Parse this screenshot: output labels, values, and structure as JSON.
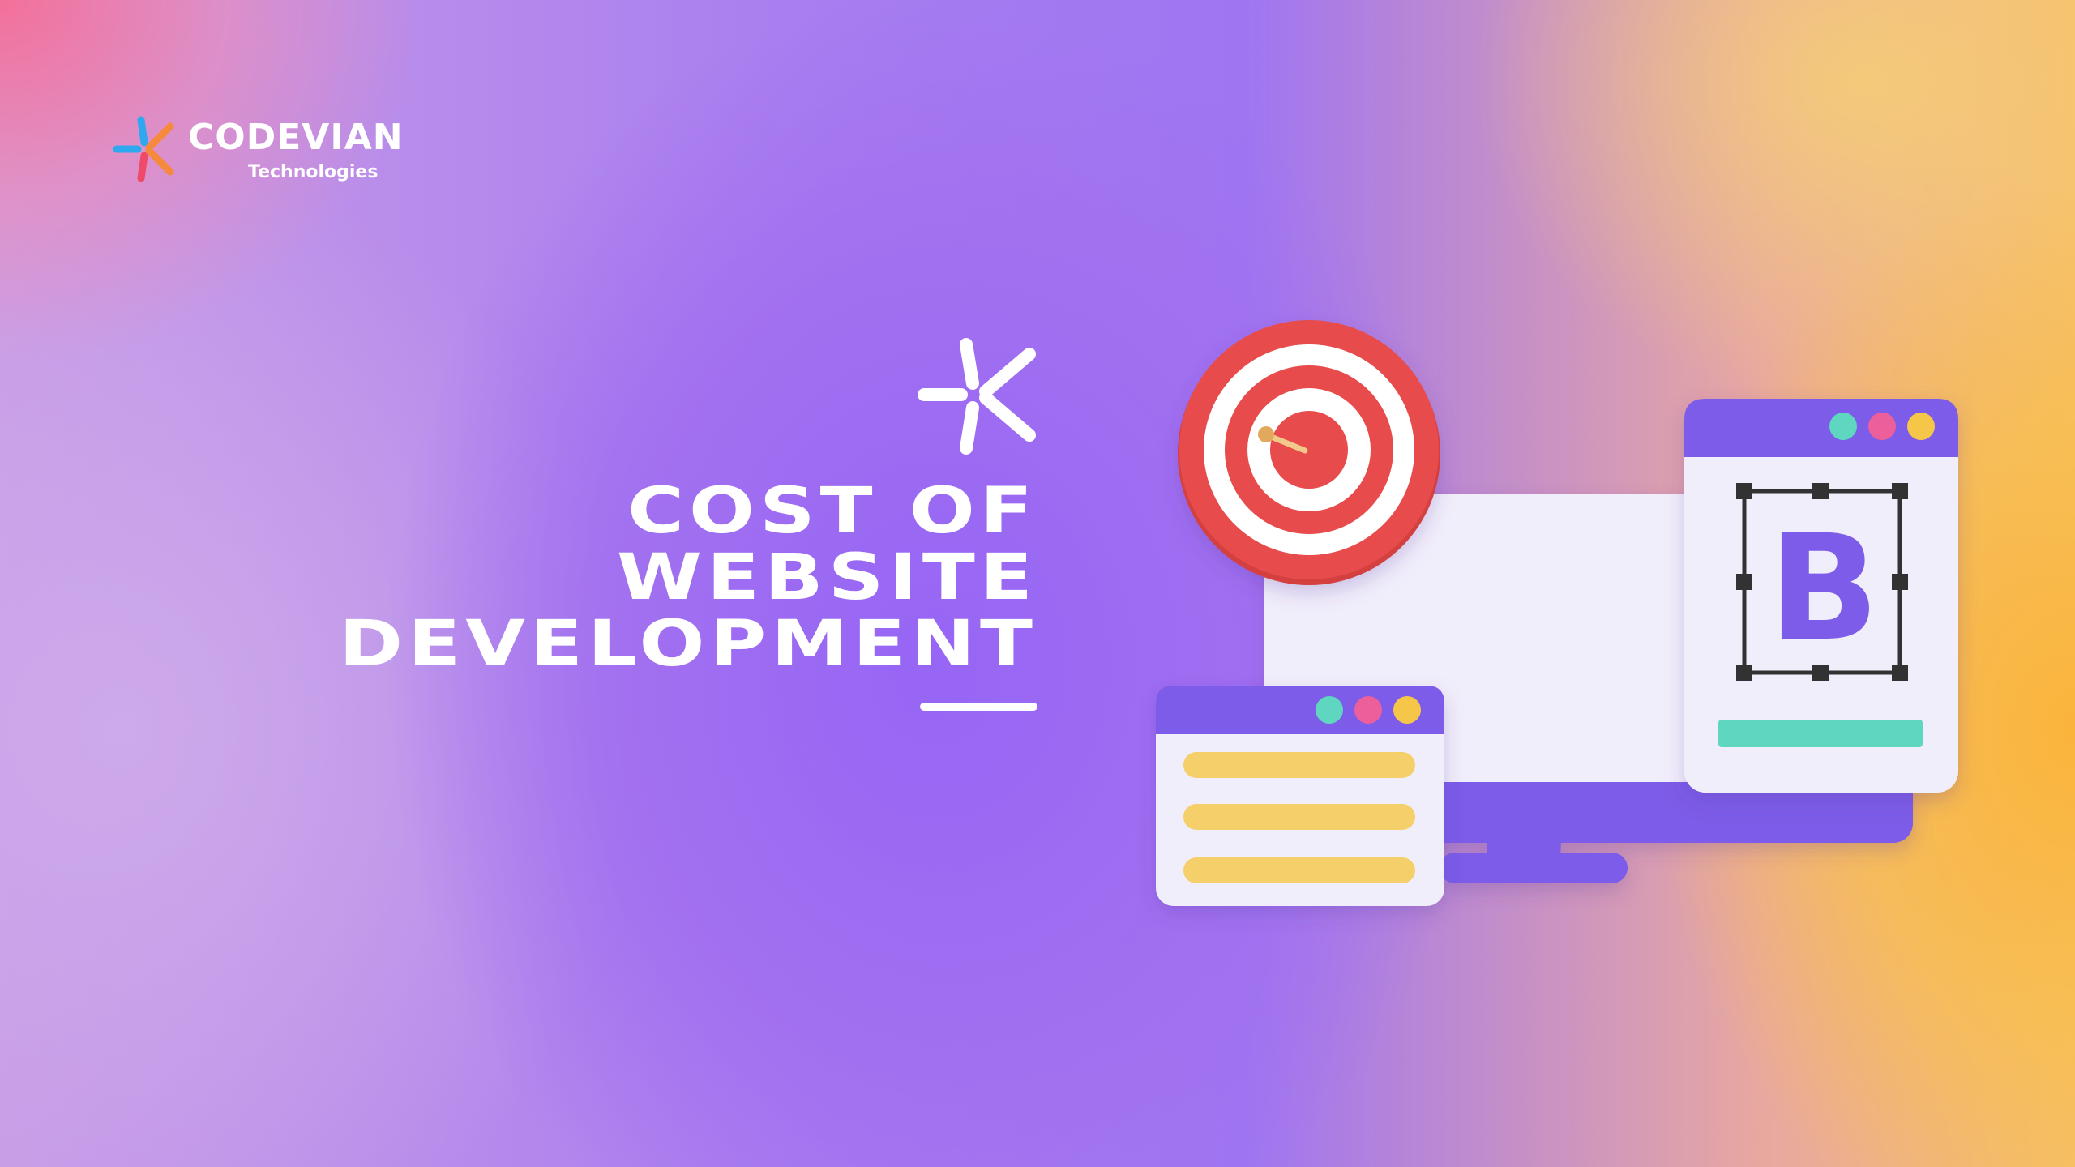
{
  "brand": {
    "name": "CODEVIAN",
    "subtitle": "Technologies"
  },
  "headline": {
    "lines": [
      "COST OF",
      "WEBSITE",
      "DEVELOPMENT"
    ]
  },
  "illustration": {
    "bold_letter": "B",
    "icons": [
      "target-icon",
      "dart-icon",
      "monitor-icon",
      "browser-window-icon",
      "text-lines-icon"
    ]
  },
  "colors": {
    "accent_purple": "#7b5ce8",
    "target_red": "#e84c4c",
    "line_yellow": "#f5cf6a",
    "bar_teal": "#5fd6bf",
    "dot_teal": "#5fd6bf",
    "dot_pink": "#ec5f9b",
    "dot_yellow": "#f6c64a",
    "logo_blue": "#2fa8f0",
    "logo_orange": "#f58a3c",
    "logo_red": "#f04a6a"
  }
}
